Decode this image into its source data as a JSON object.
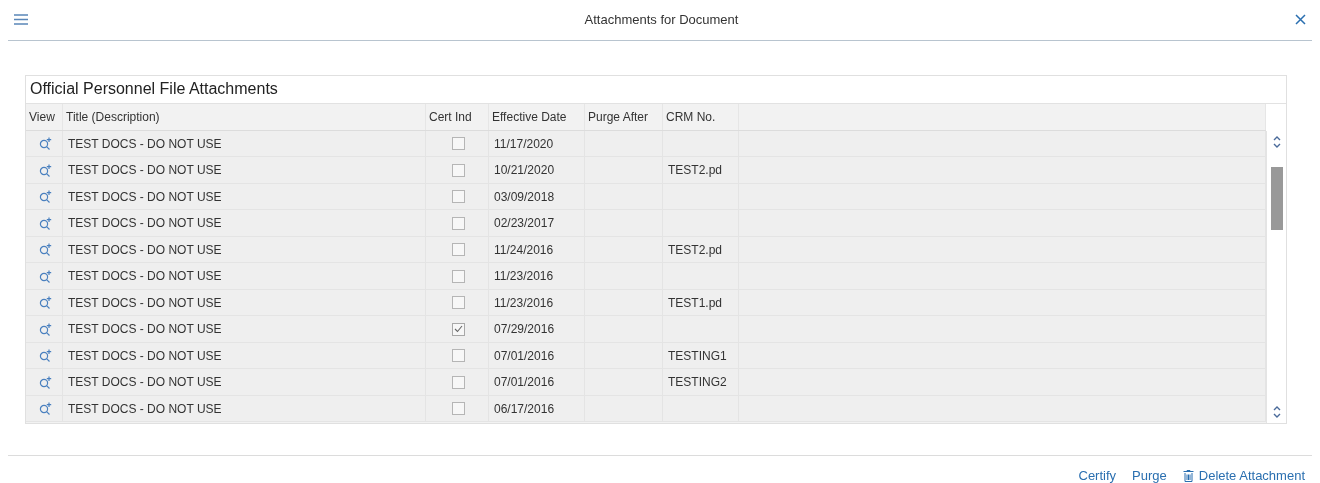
{
  "header": {
    "title": "Attachments for Document"
  },
  "panel": {
    "title": "Official Personnel File Attachments",
    "columns": [
      "View",
      "Title (Description)",
      "Cert Ind",
      "Effective Date",
      "Purge After",
      "CRM No."
    ],
    "rows": [
      {
        "title": "TEST DOCS - DO NOT USE",
        "checked": false,
        "date": "11/17/2020"
      },
      {
        "title": "TEST DOCS - DO NOT USE",
        "checked": false,
        "date": "10/21/2020",
        "crm": "TEST2.pd"
      },
      {
        "title": "TEST DOCS - DO NOT USE",
        "checked": false,
        "date": "03/09/2018"
      },
      {
        "title": "TEST DOCS - DO NOT USE",
        "checked": false,
        "date": "02/23/2017"
      },
      {
        "title": "TEST DOCS - DO NOT USE",
        "checked": false,
        "date": "11/24/2016",
        "crm": "TEST2.pd"
      },
      {
        "title": "TEST DOCS - DO NOT USE",
        "checked": false,
        "date": "11/23/2016"
      },
      {
        "title": "TEST DOCS - DO NOT USE",
        "checked": false,
        "date": "11/23/2016",
        "crm": "TEST1.pd"
      },
      {
        "title": "TEST DOCS - DO NOT USE",
        "checked": true,
        "date": "07/29/2016"
      },
      {
        "title": "TEST DOCS - DO NOT USE",
        "checked": false,
        "date": "07/01/2016",
        "crm": "TESTING1"
      },
      {
        "title": "TEST DOCS - DO NOT USE",
        "checked": false,
        "date": "07/01/2016",
        "crm": "TESTING2"
      },
      {
        "title": "TEST DOCS - DO NOT USE",
        "checked": false,
        "date": "06/17/2016"
      }
    ]
  },
  "footer": {
    "buttons": [
      {
        "label": "Certify",
        "kind": "text"
      },
      {
        "label": "Purge",
        "kind": "text"
      },
      {
        "label": "Delete Attachment",
        "kind": "trash"
      }
    ]
  }
}
